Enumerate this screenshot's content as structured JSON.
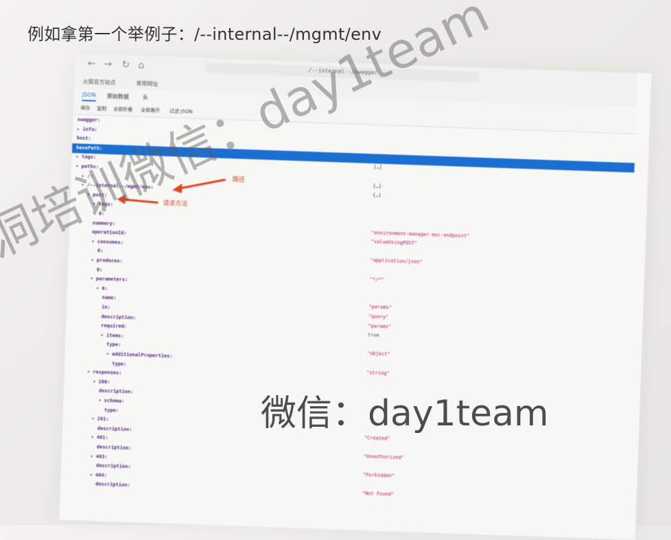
{
  "heading": "例如拿第一个举例子：/--internal--/mgmt/env",
  "browser": {
    "url": "/--internal--/swagger",
    "bookmarks": [
      "火狐官方站点",
      "常用网址"
    ],
    "viewer_tabs": [
      "JSON",
      "原始数据",
      "头"
    ],
    "actions": [
      "保存",
      "复制",
      "全部折叠",
      "全部展开",
      "过滤 JSON"
    ]
  },
  "json_tree": [
    {
      "key": "swagger:",
      "value": "",
      "depth": 0
    },
    {
      "key": "info:",
      "value": "",
      "depth": 0,
      "toggle": "▸"
    },
    {
      "key": "host:",
      "value": "",
      "depth": 0
    },
    {
      "key": "basePath:",
      "value": "",
      "depth": 0,
      "selected": true
    },
    {
      "key": "tags:",
      "value": "[…]",
      "depth": 0,
      "toggle": "▸"
    },
    {
      "key": "paths:",
      "value": "",
      "depth": 0,
      "toggle": "▾"
    },
    {
      "key": "/:",
      "value": "{…}",
      "depth": 1,
      "toggle": "▸"
    },
    {
      "key": "/--internal--/mgmt/env:",
      "value": "{…}",
      "depth": 1,
      "toggle": "▾"
    },
    {
      "key": "post:",
      "value": "",
      "depth": 2,
      "toggle": "▾"
    },
    {
      "key": "tags:",
      "value": "",
      "depth": 3,
      "toggle": "▾"
    },
    {
      "key": "0:",
      "value": "",
      "depth": 4
    },
    {
      "key": "summary:",
      "value": "\"environment-manager-mvc-endpoint\"",
      "depth": 3
    },
    {
      "key": "operationId:",
      "value": "\"valueUsingPOST\"",
      "depth": 3
    },
    {
      "key": "consumes:",
      "value": "",
      "depth": 3,
      "toggle": "▾"
    },
    {
      "key": "0:",
      "value": "\"application/json\"",
      "depth": 4
    },
    {
      "key": "produces:",
      "value": "",
      "depth": 3,
      "toggle": "▾"
    },
    {
      "key": "0:",
      "value": "\"*/*\"",
      "depth": 4
    },
    {
      "key": "parameters:",
      "value": "",
      "depth": 3,
      "toggle": "▾"
    },
    {
      "key": "0:",
      "value": "",
      "depth": 4,
      "toggle": "▾"
    },
    {
      "key": "name:",
      "value": "\"params\"",
      "depth": 5
    },
    {
      "key": "in:",
      "value": "\"query\"",
      "depth": 5
    },
    {
      "key": "description:",
      "value": "\"params\"",
      "depth": 5
    },
    {
      "key": "required:",
      "value": "true",
      "depth": 5,
      "plain": true
    },
    {
      "key": "items:",
      "value": "",
      "depth": 5,
      "toggle": "▾"
    },
    {
      "key": "type:",
      "value": "\"object\"",
      "depth": 6
    },
    {
      "key": "additionalProperties:",
      "value": "",
      "depth": 6,
      "toggle": "▾"
    },
    {
      "key": "type:",
      "value": "\"string\"",
      "depth": 7
    },
    {
      "key": "responses:",
      "value": "",
      "depth": 3,
      "toggle": "▾"
    },
    {
      "key": "200:",
      "value": "",
      "depth": 4,
      "toggle": "▾"
    },
    {
      "key": "description:",
      "value": "",
      "depth": 5
    },
    {
      "key": "schema:",
      "value": "",
      "depth": 5,
      "toggle": "▾"
    },
    {
      "key": "type:",
      "value": "",
      "depth": 6
    },
    {
      "key": "201:",
      "value": "",
      "depth": 4,
      "toggle": "▾"
    },
    {
      "key": "description:",
      "value": "\"Created\"",
      "depth": 5
    },
    {
      "key": "401:",
      "value": "",
      "depth": 4,
      "toggle": "▾"
    },
    {
      "key": "description:",
      "value": "\"Unauthorized\"",
      "depth": 5
    },
    {
      "key": "403:",
      "value": "",
      "depth": 4,
      "toggle": "▾"
    },
    {
      "key": "description:",
      "value": "\"Forbidden\"",
      "depth": 5
    },
    {
      "key": "404:",
      "value": "",
      "depth": 4,
      "toggle": "▾"
    },
    {
      "key": "description:",
      "value": "\"Not Found\"",
      "depth": 5
    }
  ],
  "annotations": {
    "path_label": "路径",
    "method_label": "请求方法"
  },
  "watermarks": {
    "diagonal": "洞培训微信：day1team",
    "center": "微信：day1team"
  },
  "colors": {
    "selection": "#1b6fd1",
    "json_key": "#5b2a86",
    "json_string": "#c0135f",
    "annotation": "#e2461e"
  }
}
